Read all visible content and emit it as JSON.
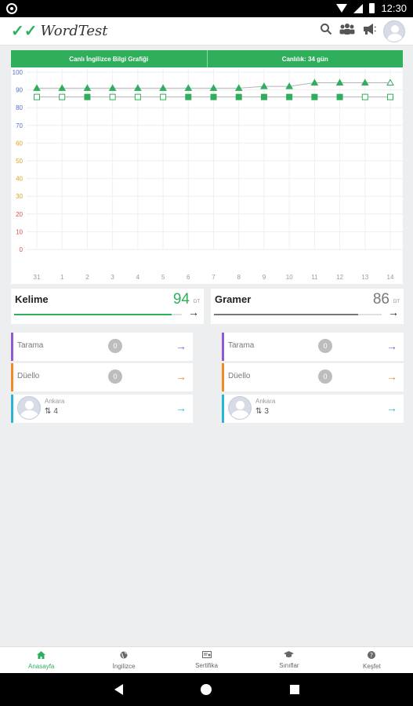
{
  "status_bar": {
    "time": "12:30"
  },
  "app": {
    "title": "WordTest",
    "logo_mark": "✓✓"
  },
  "toolbar_icons": [
    "search-icon",
    "users-icon",
    "megaphone-icon",
    "avatar"
  ],
  "chart_header": {
    "left": "Canlı İngilizce Bilgi Grafiği",
    "right": "Canlılık: 34 gün"
  },
  "chart_data": {
    "type": "line",
    "x": [
      "31",
      "1",
      "2",
      "3",
      "4",
      "5",
      "6",
      "7",
      "8",
      "9",
      "10",
      "11",
      "12",
      "13",
      "14"
    ],
    "ylim": [
      0,
      100
    ],
    "yticks": [
      0,
      10,
      20,
      30,
      40,
      50,
      60,
      70,
      80,
      90,
      100
    ],
    "grid": true,
    "series": [
      {
        "marker": "triangle",
        "color": "#2fae5c",
        "values": [
          91,
          91,
          91,
          91,
          91,
          91,
          91,
          91,
          91,
          92,
          92,
          94,
          94,
          94,
          94
        ],
        "filled": [
          true,
          true,
          true,
          true,
          true,
          true,
          true,
          true,
          true,
          true,
          true,
          true,
          true,
          true,
          false
        ]
      },
      {
        "marker": "square",
        "color": "#2fae5c",
        "values": [
          86,
          86,
          86,
          86,
          86,
          86,
          86,
          86,
          86,
          86,
          86,
          86,
          86,
          86,
          86
        ],
        "filled": [
          false,
          false,
          true,
          false,
          false,
          false,
          true,
          true,
          true,
          true,
          true,
          true,
          true,
          false,
          false
        ]
      }
    ]
  },
  "stats": {
    "kelime": {
      "label": "Kelime",
      "value": "94",
      "unit": "DT",
      "progress": 0.94,
      "color": "#2fae5c"
    },
    "gramer": {
      "label": "Gramer",
      "value": "86",
      "unit": "DT",
      "progress": 0.86,
      "color": "#777777"
    }
  },
  "left_items": {
    "tarama": {
      "label": "Tarama",
      "count": "0",
      "color": "#8e5ad6"
    },
    "duello": {
      "label": "Düello",
      "count": "0",
      "color": "#f08a24"
    },
    "rank": {
      "city": "Ankara",
      "rank_icon": "⇅",
      "rank": "4",
      "color": "#27b5d6"
    }
  },
  "right_items": {
    "tarama": {
      "label": "Tarama",
      "count": "0",
      "color": "#8e5ad6"
    },
    "duello": {
      "label": "Düello",
      "count": "0",
      "color": "#f08a24"
    },
    "rank": {
      "city": "Ankara",
      "rank_icon": "⇅",
      "rank": "3",
      "color": "#27b5d6"
    }
  },
  "bottom_nav": {
    "anasayfa": {
      "label": "Anasayfa",
      "icon": "home-icon"
    },
    "ingilizce": {
      "label": "İngilizce",
      "icon": "globe-icon"
    },
    "sertifika": {
      "label": "Sertifika",
      "icon": "certificate-icon"
    },
    "siniflar": {
      "label": "Sınıflar",
      "icon": "graduation-cap-icon"
    },
    "kesfet": {
      "label": "Keşfet",
      "icon": "help-icon"
    }
  }
}
